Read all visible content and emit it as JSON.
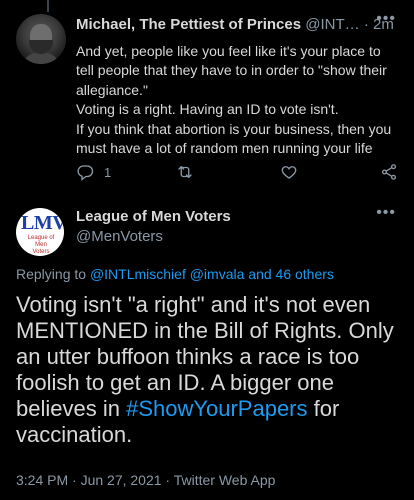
{
  "reply_tweet": {
    "display_name": "Michael, The Pettiest of Princes",
    "handle": "@INT…",
    "separator": "·",
    "time": "2m",
    "more": "•••",
    "body_lines": [
      "And yet, people like you feel like it's your place to tell people that they have to in order to \"show their allegiance.\"",
      "Voting is a right. Having an ID to vote isn't.",
      "If you think that abortion is your business, then you must have a lot of random men running your life"
    ],
    "reply_count": "1"
  },
  "main_tweet": {
    "avatar_text": "LMV",
    "avatar_subtext": "League of Men Voters",
    "display_name": "League of Men Voters",
    "handle": "@MenVoters",
    "more": "•••",
    "replying_label": "Replying to ",
    "replying_to": "@INTLmischief @imvala and 46 others",
    "body_before": "Voting isn't \"a right\" and it's not even MENTIONED in the Bill of Rights.  Only an utter buffoon thinks a race is too foolish to get an ID.  A bigger one believes in ",
    "hashtag": "#ShowYourPapers",
    "body_after": " for vaccination.",
    "meta": "3:24 PM · Jun 27, 2021 · Twitter Web App"
  },
  "colors": {
    "background": "#000000",
    "text": "#d9d9d9",
    "secondary": "#8b98a5",
    "link": "#1d9bf0"
  },
  "icons": [
    "reply-icon",
    "retweet-icon",
    "like-icon",
    "share-icon",
    "more-icon"
  ]
}
